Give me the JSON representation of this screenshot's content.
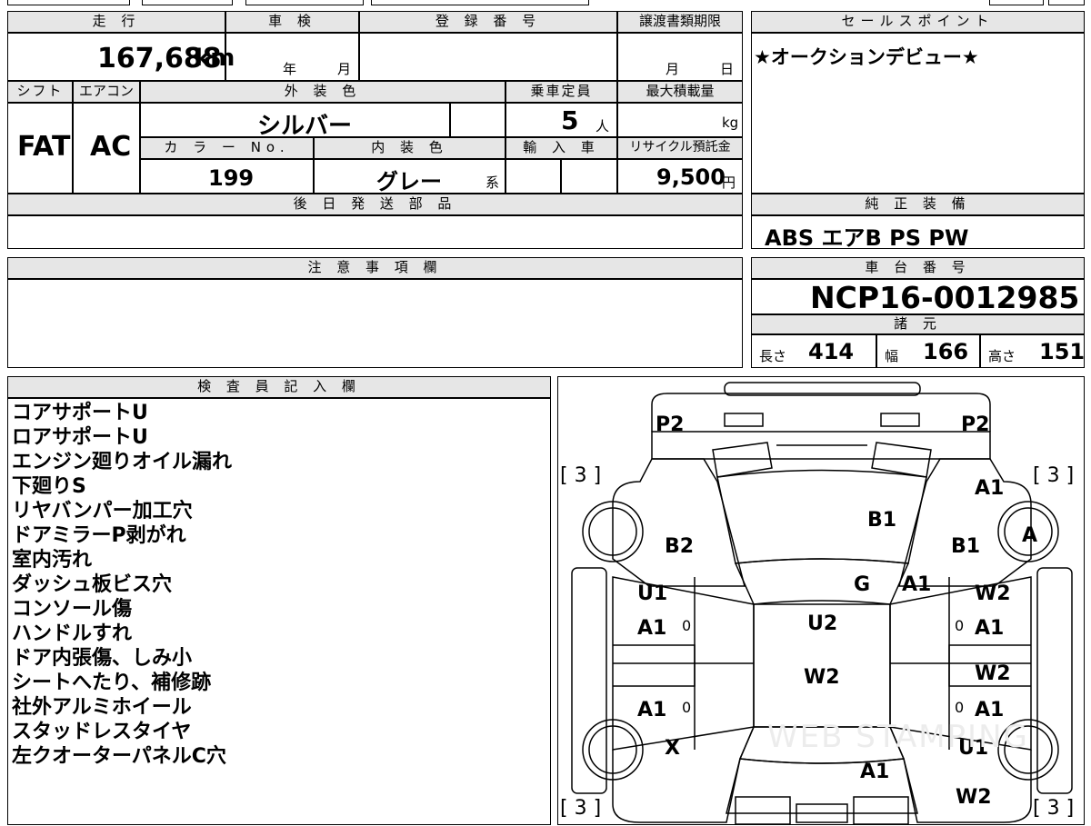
{
  "top_strip": "",
  "mileage": {
    "header": "走 行",
    "value": "167,688",
    "unit": "km"
  },
  "shaken": {
    "header": "車 検",
    "year": "年",
    "month": "月"
  },
  "registration": {
    "header": "登 録 番 号",
    "value": ""
  },
  "transfer_deadline": {
    "header": "譲渡書類期限",
    "month": "月",
    "day": "日"
  },
  "sales_point": {
    "header": "セールスポイント",
    "text": "★オークションデビュー★"
  },
  "shift": {
    "header": "シフト",
    "value": "FAT"
  },
  "aircon": {
    "header": "エアコン",
    "value": "AC"
  },
  "exterior_color": {
    "header": "外 装 色",
    "value": "シルバー"
  },
  "capacity": {
    "header": "乗車定員",
    "value": "5",
    "unit": "人"
  },
  "max_load": {
    "header": "最大積載量",
    "unit": "kg"
  },
  "color_no": {
    "header": "カ ラ ー No.",
    "value": "199"
  },
  "interior_color": {
    "header": "内 装 色",
    "value": "グレー",
    "suffix": "系"
  },
  "import": {
    "header": "輸 入 車"
  },
  "recycle": {
    "header": "リサイクル預託金",
    "value": "9,500",
    "unit": "円"
  },
  "later_parts": {
    "header": "後 日 発 送 部 品"
  },
  "genuine": {
    "header": "純 正 装 備",
    "value": "ABS エアB PS PW"
  },
  "notes": {
    "header": "注 意 事 項 欄"
  },
  "chassis": {
    "header": "車 台 番 号",
    "value": "NCP16-0012985"
  },
  "specs": {
    "header": "諸 元",
    "length_label": "長さ",
    "length": "414",
    "width_label": "幅",
    "width": "166",
    "height_label": "高さ",
    "height": "151"
  },
  "inspector": {
    "header": "検 査 員 記 入 欄",
    "lines": [
      "コアサポートU",
      "ロアサポートU",
      "エンジン廻りオイル漏れ",
      "下廻りS",
      "リヤバンパー加工穴",
      "ドアミラーP剥がれ",
      "室内汚れ",
      "ダッシュ板ビス穴",
      "コンソール傷",
      "ハンドルすれ",
      "ドア内張傷、しみ小",
      "シートへたり、補修跡",
      "社外アルミホイール",
      "スタッドレスタイヤ",
      "左クオーターパネルC穴"
    ]
  },
  "diagram": {
    "labels": {
      "p2_left": "P2",
      "p2_right": "P2",
      "bracket_tl": "[ 3 ]",
      "bracket_tr": "[ 3 ]",
      "bracket_bl": "[ 3 ]",
      "bracket_br": "[ 3 ]",
      "a1_front_right": "A1",
      "b1_hood": "B1",
      "b2_left": "B2",
      "b1_right": "B1",
      "a_wheel": "A",
      "g_windshield": "G",
      "a1_windshield_right": "A1",
      "u1_left": "U1",
      "a1_left_front_door": "A1",
      "w2_right_front": "W2",
      "a1_right_front_door": "A1",
      "u2_roof": "U2",
      "w2_roof": "W2",
      "w2_right_rear": "W2",
      "a1_left_rear_door": "A1",
      "a1_right_rear_door": "A1",
      "x_left": "X",
      "u1_right": "U1",
      "a1_rear": "A1",
      "w2_right_bottom": "W2",
      "zero": "0",
      "watermark": "WEB STAMPING"
    }
  }
}
